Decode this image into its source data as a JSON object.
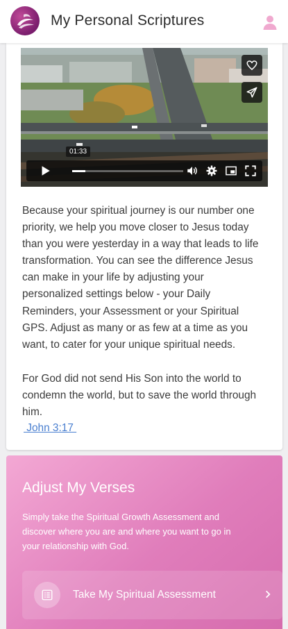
{
  "app": {
    "title": "My Personal Scriptures",
    "logo": "scriptures-logo",
    "profile_icon": "user-icon",
    "colors": {
      "brand": "#8a2478",
      "profile": "#f0a9cf",
      "link": "#4a7fd0",
      "panel_start": "#f3a8d4",
      "panel_end": "#d66cae"
    }
  },
  "video": {
    "time_tooltip": "01:33",
    "progress_fraction": 0.12,
    "actions": {
      "like_icon": "heart-icon",
      "share_icon": "send-icon"
    },
    "controls": {
      "play_icon": "play-icon",
      "volume_icon": "volume-icon",
      "settings_icon": "gear-icon",
      "pip_icon": "picture-in-picture-icon",
      "fullscreen_icon": "fullscreen-icon"
    }
  },
  "intro": {
    "body": "Because your spiritual journey is our number one priority, we help you move closer to Jesus today than you were yesterday in a way that leads to life transformation. You can see the difference Jesus can make in your life by adjusting your personalized settings below - your Daily Reminders, your Assessment or your Spiritual GPS. Adjust as many or as few at a time as you want, to cater for your unique spiritual needs.",
    "verse": "For God did not send His Son into the world to condemn the world, but to save the world through him.",
    "verse_ref": " John 3:17 "
  },
  "adjust": {
    "title": "Adjust My Verses",
    "description": "Simply take the Spiritual Growth Assessment and discover where you are and where you want to go in your relationship with God.",
    "button_label": "Take My Spiritual Assessment",
    "button_icon": "list-icon",
    "chevron_icon": "chevron-right-icon"
  }
}
